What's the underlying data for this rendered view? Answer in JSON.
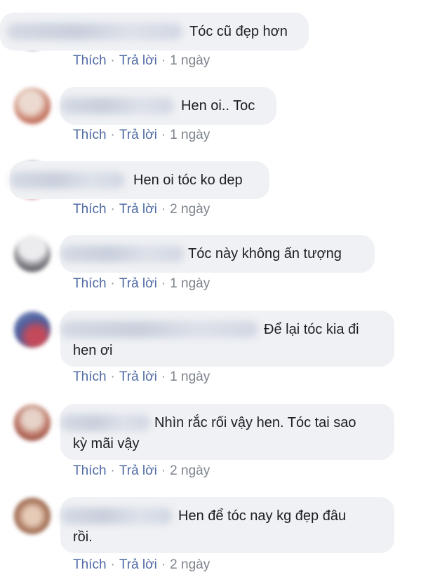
{
  "comments": [
    {
      "text_line1": "Tóc cũ đẹp hơn",
      "text_line2": "",
      "like": "Thích",
      "reply": "Trả lời",
      "time": "1 ngày",
      "avatar_colors": [
        "#2a2a2a",
        "#f0f0f0"
      ]
    },
    {
      "text_line1": "Hen oi.. Toc",
      "text_line2": "",
      "like": "Thích",
      "reply": "Trả lời",
      "time": "1 ngày",
      "avatar_colors": [
        "#c9826e",
        "#e9d6cc"
      ]
    },
    {
      "text_line1": "Hen oi tóc ko dep",
      "text_line2": "",
      "like": "Thích",
      "reply": "Trả lời",
      "time": "2 ngày",
      "avatar_colors": [
        "#d14b4b",
        "#9a9aa0"
      ]
    },
    {
      "text_line1": "Tóc này không ấn tượng",
      "text_line2": "",
      "like": "Thích",
      "reply": "Trả lời",
      "time": "1 ngày",
      "avatar_colors": [
        "#6b6b70",
        "#e6e6ea"
      ]
    },
    {
      "text_line1": "Để lại tóc kia đi",
      "text_line2": "hen ơi",
      "like": "Thích",
      "reply": "Trả lời",
      "time": "1 ngày",
      "avatar_colors": [
        "#4a5fa0",
        "#c24a5a"
      ]
    },
    {
      "text_line1": "Nhìn rắc rối vậy hen. Tóc tai sao",
      "text_line2": "kỳ mãi vậy",
      "like": "Thích",
      "reply": "Trả lời",
      "time": "2 ngày",
      "avatar_colors": [
        "#b56a5a",
        "#e7d3c8"
      ]
    },
    {
      "text_line1": "Hen để tóc nay kg đẹp đâu",
      "text_line2": "rồi.",
      "like": "Thích",
      "reply": "Trả lời",
      "time": "2 ngày",
      "avatar_colors": [
        "#8c5a40",
        "#e6cbb8"
      ]
    }
  ]
}
